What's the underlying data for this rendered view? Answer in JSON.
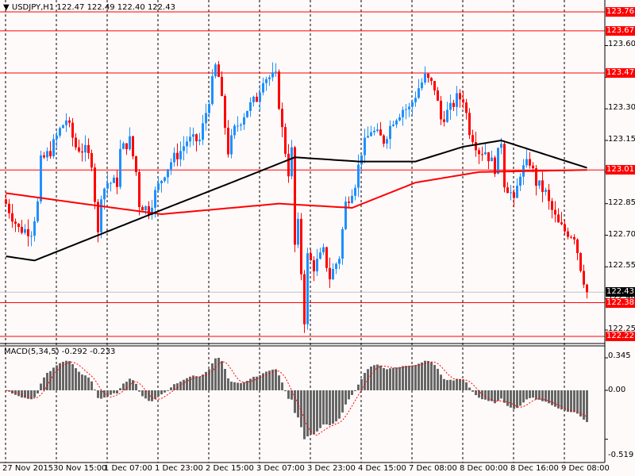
{
  "header": {
    "symbol": "USDJPY,H1",
    "open": "122.47",
    "high": "122.49",
    "low": "122.40",
    "close": "122.43"
  },
  "colors": {
    "up": "#1e90ff",
    "down": "#ff0000",
    "level": "#ff0000",
    "ma_fast": "#ff0000",
    "ma_slow": "#000000",
    "macd_hist": "#666666",
    "macd_signal": "#ff0000",
    "bg": "#fffafa"
  },
  "price_axis": {
    "min": 122.22,
    "max": 123.76,
    "ticks": [
      "123.60",
      "123.45",
      "123.30",
      "123.15",
      "123.00",
      "122.85",
      "122.70",
      "122.55",
      "122.40",
      "122.25"
    ]
  },
  "levels": [
    {
      "value": 123.76,
      "label": "123.76"
    },
    {
      "value": 123.67,
      "label": "123.67"
    },
    {
      "value": 123.47,
      "label": "123.47"
    },
    {
      "value": 123.01,
      "label": "123.01"
    },
    {
      "value": 122.38,
      "label": "122.38"
    },
    {
      "value": 122.22,
      "label": "122.22"
    }
  ],
  "current_price": {
    "value": 122.43,
    "label": "122.43"
  },
  "macd": {
    "label": "MACD(5,34,5) -0.292 -0.233",
    "max_label": "0.345",
    "zero_label": "0.00",
    "min_label": "-0.519",
    "max": 0.345,
    "min": -0.519
  },
  "time_axis": [
    {
      "index": 0,
      "label": "27 Nov 2015"
    },
    {
      "index": 16,
      "label": "30 Nov 15:00"
    },
    {
      "index": 32,
      "label": "1 Dec 07:00"
    },
    {
      "index": 48,
      "label": "1 Dec 23:00"
    },
    {
      "index": 64,
      "label": "2 Dec 15:00"
    },
    {
      "index": 80,
      "label": "3 Dec 07:00"
    },
    {
      "index": 96,
      "label": "3 Dec 23:00"
    },
    {
      "index": 112,
      "label": "4 Dec 15:00"
    },
    {
      "index": 128,
      "label": "7 Dec 08:00"
    },
    {
      "index": 144,
      "label": "8 Dec 00:00"
    },
    {
      "index": 160,
      "label": "8 Dec 16:00"
    },
    {
      "index": 176,
      "label": "9 Dec 08:00"
    }
  ],
  "chart_data": {
    "type": "candlestick",
    "candle_count": 184,
    "close_path": [
      [
        0,
        122.85
      ],
      [
        4,
        122.73
      ],
      [
        8,
        122.72
      ],
      [
        10,
        122.85
      ],
      [
        11,
        123.05
      ],
      [
        14,
        123.1
      ],
      [
        17,
        123.2
      ],
      [
        19,
        123.25
      ],
      [
        22,
        123.12
      ],
      [
        25,
        123.1
      ],
      [
        27,
        123.05
      ],
      [
        29,
        122.7
      ],
      [
        30,
        122.9
      ],
      [
        32,
        122.95
      ],
      [
        35,
        122.95
      ],
      [
        36,
        123.1
      ],
      [
        39,
        123.15
      ],
      [
        41,
        123.0
      ],
      [
        42,
        122.85
      ],
      [
        45,
        122.82
      ],
      [
        47,
        122.9
      ],
      [
        50,
        123.0
      ],
      [
        52,
        123.05
      ],
      [
        55,
        123.1
      ],
      [
        57,
        123.15
      ],
      [
        61,
        123.15
      ],
      [
        64,
        123.35
      ],
      [
        66,
        123.5
      ],
      [
        67,
        123.45
      ],
      [
        70,
        123.1
      ],
      [
        72,
        123.2
      ],
      [
        76,
        123.3
      ],
      [
        79,
        123.35
      ],
      [
        81,
        123.45
      ],
      [
        85,
        123.45
      ],
      [
        87,
        123.2
      ],
      [
        89,
        123.0
      ],
      [
        90,
        123.1
      ],
      [
        91,
        122.65
      ],
      [
        92,
        122.75
      ],
      [
        94,
        122.3
      ],
      [
        95,
        122.6
      ],
      [
        97,
        122.55
      ],
      [
        100,
        122.62
      ],
      [
        102,
        122.5
      ],
      [
        105,
        122.6
      ],
      [
        107,
        122.85
      ],
      [
        110,
        122.95
      ],
      [
        112,
        123.1
      ],
      [
        115,
        123.2
      ],
      [
        119,
        123.15
      ],
      [
        122,
        123.25
      ],
      [
        125,
        123.3
      ],
      [
        127,
        123.3
      ],
      [
        130,
        123.4
      ],
      [
        132,
        123.45
      ],
      [
        135,
        123.4
      ],
      [
        137,
        123.25
      ],
      [
        140,
        123.3
      ],
      [
        142,
        123.35
      ],
      [
        144,
        123.35
      ],
      [
        146,
        123.2
      ],
      [
        149,
        123.1
      ],
      [
        151,
        123.1
      ],
      [
        154,
        123.02
      ],
      [
        156,
        123.15
      ],
      [
        157,
        122.95
      ],
      [
        159,
        122.9
      ],
      [
        160,
        122.85
      ],
      [
        162,
        123.0
      ],
      [
        165,
        123.05
      ],
      [
        167,
        122.95
      ],
      [
        170,
        122.9
      ],
      [
        171,
        122.85
      ],
      [
        174,
        122.75
      ],
      [
        176,
        122.72
      ],
      [
        179,
        122.7
      ],
      [
        181,
        122.55
      ],
      [
        183,
        122.43
      ]
    ],
    "ma_red": [
      [
        0,
        122.9
      ],
      [
        24,
        122.85
      ],
      [
        49,
        122.8
      ],
      [
        86,
        122.85
      ],
      [
        109,
        122.83
      ],
      [
        129,
        122.95
      ],
      [
        149,
        123.0
      ],
      [
        183,
        123.01
      ]
    ],
    "ma_black": [
      [
        0,
        122.6
      ],
      [
        9,
        122.58
      ],
      [
        29,
        122.7
      ],
      [
        49,
        122.82
      ],
      [
        71,
        122.95
      ],
      [
        91,
        123.07
      ],
      [
        111,
        123.05
      ],
      [
        129,
        123.05
      ],
      [
        144,
        123.12
      ],
      [
        156,
        123.15
      ],
      [
        183,
        123.02
      ]
    ]
  }
}
